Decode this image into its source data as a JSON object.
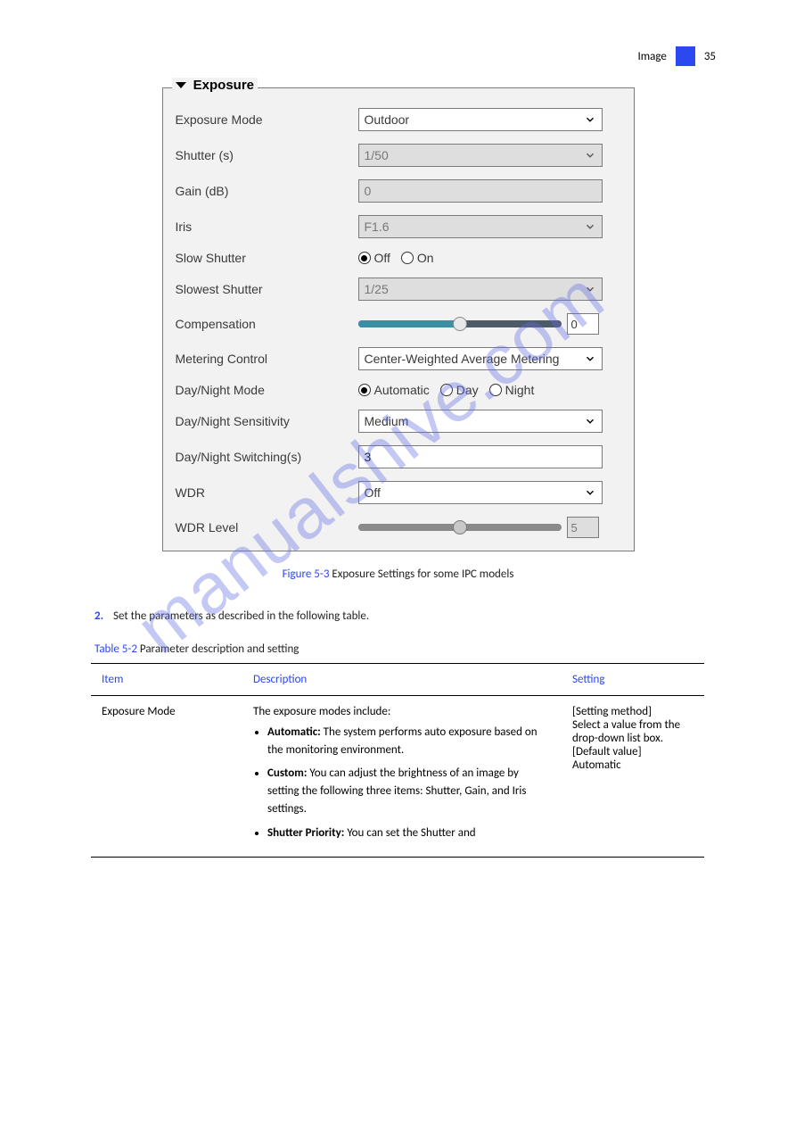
{
  "header": {
    "pagenum": "35",
    "title": "Image"
  },
  "panel": {
    "title": "Exposure",
    "rows": {
      "exposure_mode": {
        "label": "Exposure Mode",
        "value": "Outdoor"
      },
      "shutter": {
        "label": "Shutter (s)",
        "value": "1/50"
      },
      "gain": {
        "label": "Gain (dB)",
        "value": "0"
      },
      "iris": {
        "label": "Iris",
        "value": "F1.6"
      },
      "slow_shutter": {
        "label": "Slow Shutter",
        "off": "Off",
        "on": "On",
        "selected": "Off"
      },
      "slowest": {
        "label": "Slowest Shutter",
        "value": "1/25"
      },
      "compensation": {
        "label": "Compensation",
        "value": "0",
        "pct": 50
      },
      "metering": {
        "label": "Metering Control",
        "value": "Center-Weighted Average Metering"
      },
      "daynight": {
        "label": "Day/Night Mode",
        "auto": "Automatic",
        "day": "Day",
        "night": "Night",
        "selected": "Automatic"
      },
      "dn_sens": {
        "label": "Day/Night Sensitivity",
        "value": "Medium"
      },
      "dn_switch": {
        "label": "Day/Night Switching(s)",
        "value": "3"
      },
      "wdr": {
        "label": "WDR",
        "value": "Off"
      },
      "wdr_level": {
        "label": "WDR Level",
        "value": "5",
        "pct": 50
      }
    }
  },
  "caption": "Figure 5-3",
  "captiontxt": "Exposure Settings for some IPC models",
  "step": {
    "n": "2.",
    "text": "Set the parameters as described in the following table."
  },
  "tablecap": {
    "n": "Table 5-2",
    "t": "Parameter description and setting"
  },
  "tbl": {
    "h1": "Item",
    "h2": "Description",
    "h3": "Setting",
    "p1": "Exposure Mode",
    "d1": "The exposure modes include:",
    "li1": {
      "b": "Automatic:",
      "t": " The system performs auto exposure based on the monitoring environment."
    },
    "li2": {
      "b": "Custom:",
      "t": " You can adjust the brightness of an image by setting the following three items: Shutter, Gain, and Iris settings."
    },
    "li3": {
      "b": "Shutter Priority:",
      "t": " You can set the Shutter and"
    },
    "s1": "[Setting method]\nSelect a value from the drop-down list box.\n[Default value]\nAutomatic"
  },
  "watermark": "manualshive.com"
}
